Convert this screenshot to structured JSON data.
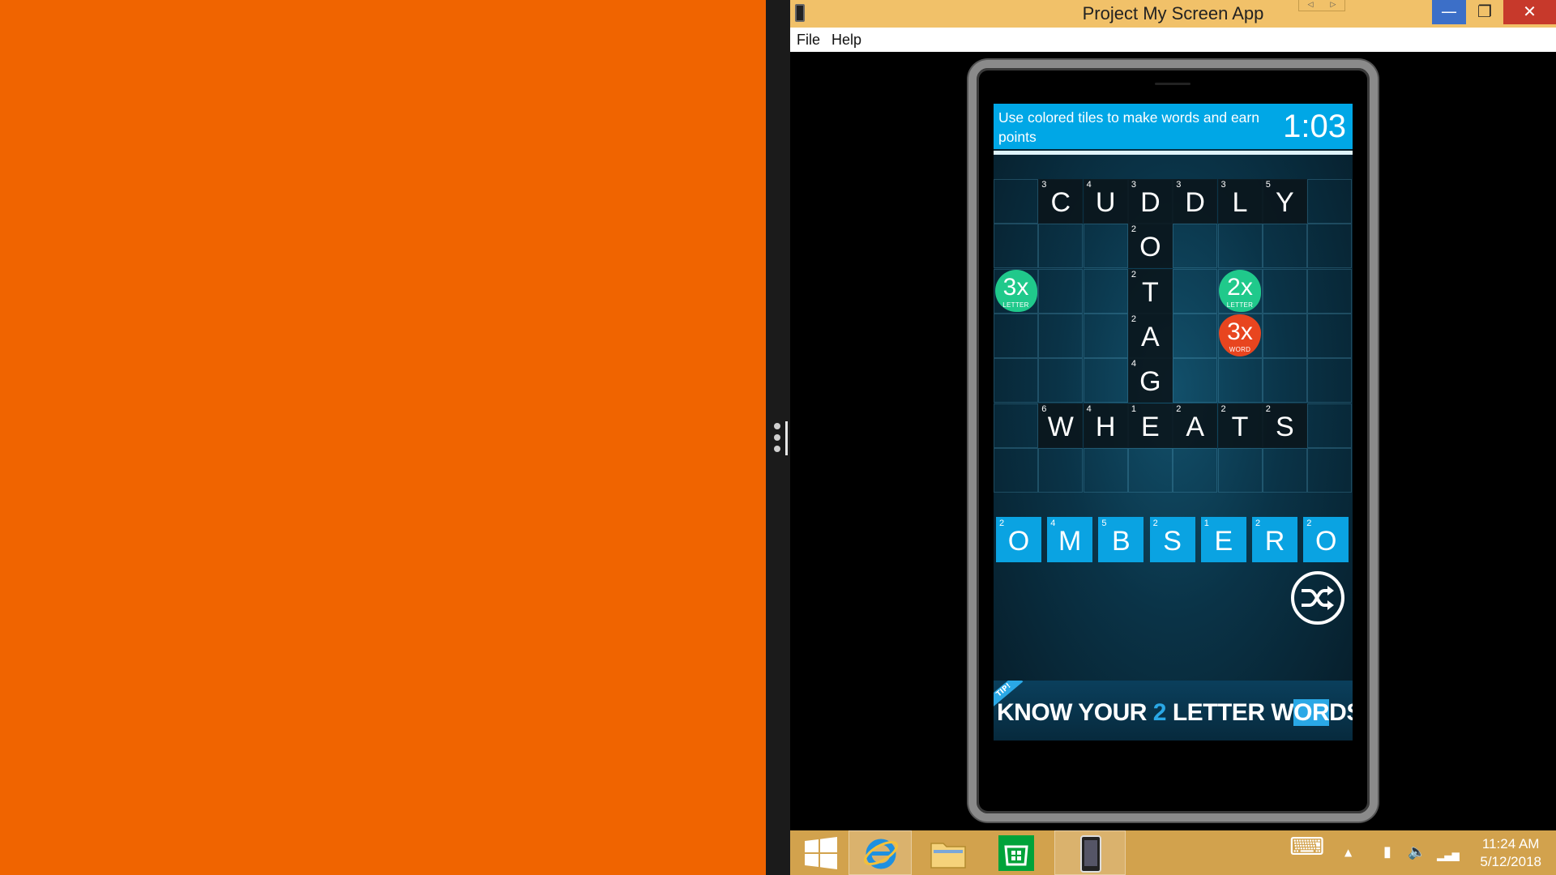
{
  "window": {
    "title": "Project My Screen App",
    "mini_nav_back": "◁",
    "mini_nav_forward": "▷",
    "minimize_glyph": "—",
    "maximize_glyph": "❐",
    "close_glyph": "✕"
  },
  "menu": {
    "file_label": "File",
    "help_label": "Help"
  },
  "game": {
    "instruction": "Use colored tiles to make words and earn points",
    "timer": "1:03",
    "board_rows": 7,
    "board_cols": 8,
    "tiles": [
      {
        "letter": "C",
        "score": "3",
        "row": 0,
        "col": 1
      },
      {
        "letter": "U",
        "score": "4",
        "row": 0,
        "col": 2
      },
      {
        "letter": "D",
        "score": "3",
        "row": 0,
        "col": 3
      },
      {
        "letter": "D",
        "score": "3",
        "row": 0,
        "col": 4
      },
      {
        "letter": "L",
        "score": "3",
        "row": 0,
        "col": 5
      },
      {
        "letter": "Y",
        "score": "5",
        "row": 0,
        "col": 6
      },
      {
        "letter": "O",
        "score": "2",
        "row": 1,
        "col": 3
      },
      {
        "letter": "T",
        "score": "2",
        "row": 2,
        "col": 3
      },
      {
        "letter": "A",
        "score": "2",
        "row": 3,
        "col": 3
      },
      {
        "letter": "G",
        "score": "4",
        "row": 4,
        "col": 3
      },
      {
        "letter": "W",
        "score": "6",
        "row": 5,
        "col": 1
      },
      {
        "letter": "H",
        "score": "4",
        "row": 5,
        "col": 2
      },
      {
        "letter": "E",
        "score": "1",
        "row": 5,
        "col": 3
      },
      {
        "letter": "A",
        "score": "2",
        "row": 5,
        "col": 4
      },
      {
        "letter": "T",
        "score": "2",
        "row": 5,
        "col": 5
      },
      {
        "letter": "S",
        "score": "2",
        "row": 5,
        "col": 6
      }
    ],
    "bonuses": [
      {
        "mult": "3x",
        "kind": "LETTER",
        "color": "#20c98b",
        "row": 2,
        "col": 0
      },
      {
        "mult": "2x",
        "kind": "LETTER",
        "color": "#20c98b",
        "row": 2,
        "col": 5
      },
      {
        "mult": "3x",
        "kind": "WORD",
        "color": "#e8451f",
        "row": 3,
        "col": 5
      }
    ],
    "rack": [
      {
        "letter": "O",
        "score": "2"
      },
      {
        "letter": "M",
        "score": "4"
      },
      {
        "letter": "B",
        "score": "5"
      },
      {
        "letter": "S",
        "score": "2"
      },
      {
        "letter": "E",
        "score": "1"
      },
      {
        "letter": "R",
        "score": "2"
      },
      {
        "letter": "O",
        "score": "2"
      }
    ],
    "ad": {
      "tip": "TIP!",
      "part1": "KNOW YOUR ",
      "part2": "2",
      "part3": " LETTER W",
      "part4": "O",
      "part5": "R",
      "part6": "DS"
    }
  },
  "colors": {
    "desktop_orange": "#f06400",
    "accent_blue": "#00a7e6",
    "taskbar": "#d2a24d"
  },
  "taskbar": {
    "items": [
      "windows-logo-icon",
      "internet-explorer-icon",
      "file-explorer-icon",
      "store-icon",
      "project-my-screen-icon"
    ],
    "time": "11:24 AM",
    "date": "5/12/2018",
    "keyboard_glyph": "⌨",
    "chevron_glyph": "▲",
    "battery_glyph": "▮",
    "volume_glyph": "🔈",
    "signal_glyph": "▂▄▆"
  }
}
